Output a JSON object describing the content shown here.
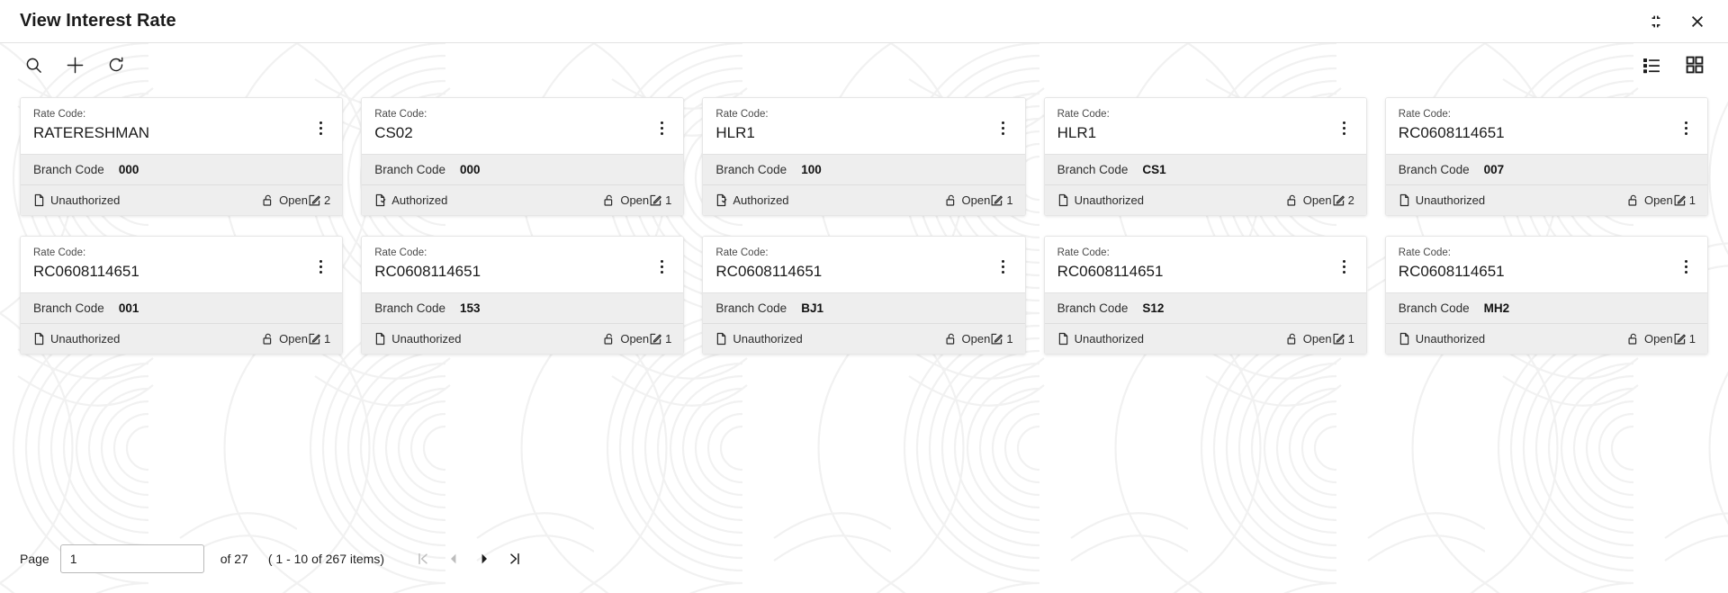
{
  "window": {
    "title": "View Interest Rate",
    "minimize_icon": "collapse-icon",
    "close_icon": "close-icon"
  },
  "toolbar": {
    "search_icon": "search-icon",
    "add_icon": "plus-icon",
    "refresh_icon": "refresh-icon",
    "list_view_icon": "list-view-icon",
    "grid_view_icon": "grid-view-icon"
  },
  "card_labels": {
    "rate_code": "Rate Code:",
    "branch_code": "Branch Code",
    "menu_icon": "kebab-menu-icon"
  },
  "cards": [
    {
      "rate_code": "RATERESHMAN",
      "branch_code": "000",
      "auth_status": "Unauthorized",
      "auth_icon": "document-icon",
      "record_status": "Open",
      "lock_icon": "unlock-icon",
      "mod_count": "2",
      "mod_icon": "edit-icon"
    },
    {
      "rate_code": "CS02",
      "branch_code": "000",
      "auth_status": "Authorized",
      "auth_icon": "document-check-icon",
      "record_status": "Open",
      "lock_icon": "unlock-icon",
      "mod_count": "1",
      "mod_icon": "edit-icon"
    },
    {
      "rate_code": "HLR1",
      "branch_code": "100",
      "auth_status": "Authorized",
      "auth_icon": "document-check-icon",
      "record_status": "Open",
      "lock_icon": "unlock-icon",
      "mod_count": "1",
      "mod_icon": "edit-icon"
    },
    {
      "rate_code": "HLR1",
      "branch_code": "CS1",
      "auth_status": "Unauthorized",
      "auth_icon": "document-icon",
      "record_status": "Open",
      "lock_icon": "unlock-icon",
      "mod_count": "2",
      "mod_icon": "edit-icon"
    },
    {
      "rate_code": "RC0608114651",
      "branch_code": "007",
      "auth_status": "Unauthorized",
      "auth_icon": "document-icon",
      "record_status": "Open",
      "lock_icon": "unlock-icon",
      "mod_count": "1",
      "mod_icon": "edit-icon"
    },
    {
      "rate_code": "RC0608114651",
      "branch_code": "001",
      "auth_status": "Unauthorized",
      "auth_icon": "document-icon",
      "record_status": "Open",
      "lock_icon": "unlock-icon",
      "mod_count": "1",
      "mod_icon": "edit-icon"
    },
    {
      "rate_code": "RC0608114651",
      "branch_code": "153",
      "auth_status": "Unauthorized",
      "auth_icon": "document-icon",
      "record_status": "Open",
      "lock_icon": "unlock-icon",
      "mod_count": "1",
      "mod_icon": "edit-icon"
    },
    {
      "rate_code": "RC0608114651",
      "branch_code": "BJ1",
      "auth_status": "Unauthorized",
      "auth_icon": "document-icon",
      "record_status": "Open",
      "lock_icon": "unlock-icon",
      "mod_count": "1",
      "mod_icon": "edit-icon"
    },
    {
      "rate_code": "RC0608114651",
      "branch_code": "S12",
      "auth_status": "Unauthorized",
      "auth_icon": "document-icon",
      "record_status": "Open",
      "lock_icon": "unlock-icon",
      "mod_count": "1",
      "mod_icon": "edit-icon"
    },
    {
      "rate_code": "RC0608114651",
      "branch_code": "MH2",
      "auth_status": "Unauthorized",
      "auth_icon": "document-icon",
      "record_status": "Open",
      "lock_icon": "unlock-icon",
      "mod_count": "1",
      "mod_icon": "edit-icon"
    }
  ],
  "pagination": {
    "page_label": "Page",
    "page_value": "1",
    "of_text": "of 27",
    "range_text": "( 1 - 10 of 267 items)",
    "first_icon": "first-page-icon",
    "prev_icon": "prev-page-icon",
    "next_icon": "next-page-icon",
    "last_icon": "last-page-icon"
  },
  "colors": {
    "card_detail_bg": "#eeeeee",
    "border": "#e6e6e6",
    "text": "#1b1b1b"
  }
}
